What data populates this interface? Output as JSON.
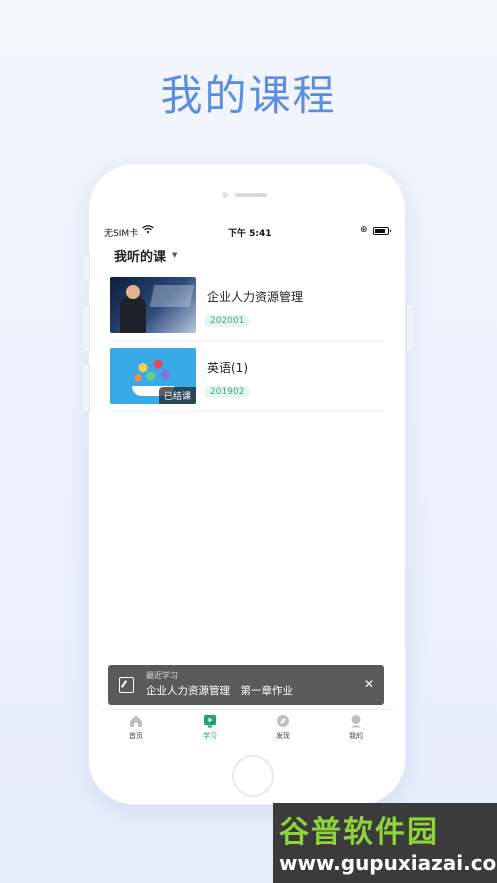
{
  "headline": "我的课程",
  "status_bar": {
    "carrier": "无SIM卡",
    "time": "下午 5:41"
  },
  "selector": {
    "label": "我听的课"
  },
  "courses": [
    {
      "title": "企业人力资源管理",
      "tag": "202001",
      "badge": ""
    },
    {
      "title": "英语(1)",
      "tag": "201902",
      "badge": "已结课"
    }
  ],
  "recent": {
    "label": "最近学习",
    "text": "企业人力资源管理　第一章作业"
  },
  "tabs": [
    {
      "label": "首页",
      "icon": "home-icon",
      "active": false
    },
    {
      "label": "学习",
      "icon": "play-icon",
      "active": true
    },
    {
      "label": "发现",
      "icon": "discover-icon",
      "active": false
    },
    {
      "label": "我的",
      "icon": "profile-icon",
      "active": false
    }
  ],
  "watermark": {
    "title": "谷普软件园",
    "url": "www.gupuxiazai.com"
  },
  "colors": {
    "accent": "#1aa37a",
    "headline": "#5b8ee0",
    "tag_bg": "#e6f5f0"
  }
}
